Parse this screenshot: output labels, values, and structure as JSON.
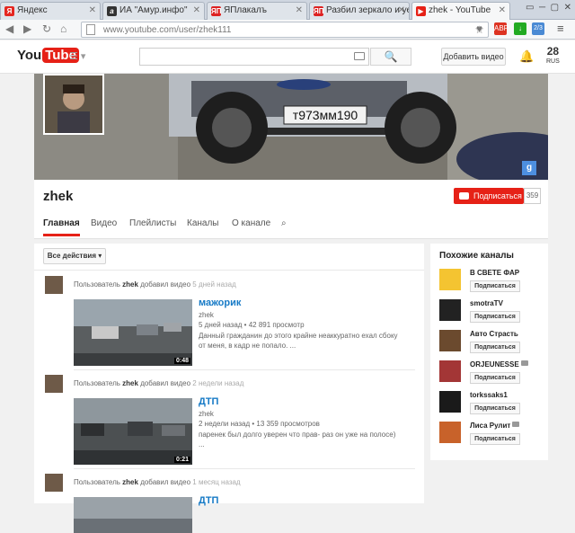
{
  "browser": {
    "tabs": [
      {
        "icon": "yandex-icon",
        "label": "Яндекс"
      },
      {
        "icon": "amur-info-icon",
        "label": "ИА \"Амур.инфо\""
      },
      {
        "icon": "yaplakal-icon",
        "label": "ЯПлакалъ"
      },
      {
        "icon": "yaplakal-icon",
        "label": "Разбил зеркало и уе"
      },
      {
        "icon": "youtube-icon",
        "label": "zhek - YouTube"
      }
    ],
    "url": "www.youtube.com/user/zhek111",
    "ext_badge": "2/3"
  },
  "header": {
    "logo_text": "You",
    "logo_box": "Tube",
    "search_placeholder": "",
    "search_button": "🔍",
    "upload_label": "Добавить видео",
    "count": "28",
    "count_sub": "RUS"
  },
  "banner": {
    "plate": "т973мм190"
  },
  "channel": {
    "name": "zhek",
    "subscribe_label": "Подписаться",
    "subscriber_count": "359",
    "tabs": [
      "Главная",
      "Видео",
      "Плейлисты",
      "Каналы",
      "О канале"
    ]
  },
  "feed": {
    "actions_label": "Все действия",
    "items": [
      {
        "prefix": "Пользователь",
        "user": "zhek",
        "action": "добавил видео",
        "ago": "5 дней назад",
        "title": "мажорик",
        "author": "zhek",
        "stats": "5 дней назад • 42 891 просмотр",
        "desc1": "Данный гражданин до этого крайне неаккуратно ехал сбоку",
        "desc2": "от меня, в кадр не попало. ...",
        "duration": "0:48"
      },
      {
        "prefix": "Пользователь",
        "user": "zhek",
        "action": "добавил видео",
        "ago": "2 недели назад",
        "title": "ДТП",
        "author": "zhek",
        "stats": "2 недели назад • 13 359 просмотров",
        "desc1": "паренек был долго уверен что прав- раз он уже на полосе)",
        "desc2": "...",
        "duration": "0:21"
      },
      {
        "prefix": "Пользователь",
        "user": "zhek",
        "action": "добавил видео",
        "ago": "1 месяц назад",
        "title": "ДТП"
      }
    ]
  },
  "sidebar": {
    "title": "Похожие каналы",
    "button": "Подписаться",
    "channels": [
      {
        "name": "В СВЕТЕ ФАР",
        "verified": false,
        "color": "#f4c431"
      },
      {
        "name": "smotraTV",
        "verified": false,
        "color": "#222222"
      },
      {
        "name": "Авто Страсть",
        "verified": false,
        "color": "#6b4a2e"
      },
      {
        "name": "ORJEUNESSE",
        "verified": true,
        "color": "#a33636"
      },
      {
        "name": "torkssaks1",
        "verified": false,
        "color": "#1a1a1a"
      },
      {
        "name": "Лиса Рулит",
        "verified": true,
        "color": "#c8622a"
      }
    ]
  }
}
